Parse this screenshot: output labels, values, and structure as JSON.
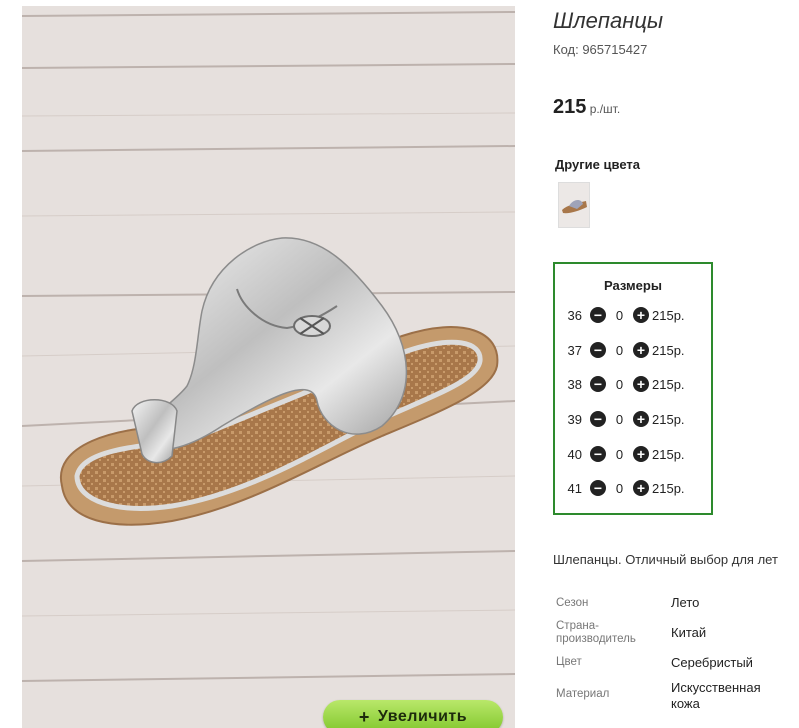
{
  "product": {
    "title": "Шлепанцы",
    "code_label": "Код: 965715427",
    "price_value": "215",
    "price_unit": " р./шт."
  },
  "photo": {
    "zoom_plus": "+",
    "zoom_label": "Увеличить"
  },
  "other_colors": {
    "title": "Другие цвета"
  },
  "sizes": {
    "title": "Размеры",
    "rows": [
      {
        "size": "36",
        "qty": "0",
        "price": "215р."
      },
      {
        "size": "37",
        "qty": "0",
        "price": "215р."
      },
      {
        "size": "38",
        "qty": "0",
        "price": "215р."
      },
      {
        "size": "39",
        "qty": "0",
        "price": "215р."
      },
      {
        "size": "40",
        "qty": "0",
        "price": "215р."
      },
      {
        "size": "41",
        "qty": "0",
        "price": "215р."
      }
    ],
    "minus_glyph": "−",
    "plus_glyph": "+"
  },
  "description": "Шлепанцы. Отличный выбор для лет",
  "properties": [
    {
      "name": "Сезон",
      "value": "Лето"
    },
    {
      "name": "Страна-\nпроизводитель",
      "value": "Китай"
    },
    {
      "name": "Цвет",
      "value": "Серебристый"
    },
    {
      "name": "Материал",
      "value": "Искусственная\nкожа"
    }
  ],
  "colors": {
    "accent_green": "#2d8a2d",
    "zoom_green": "#8fd13a"
  }
}
